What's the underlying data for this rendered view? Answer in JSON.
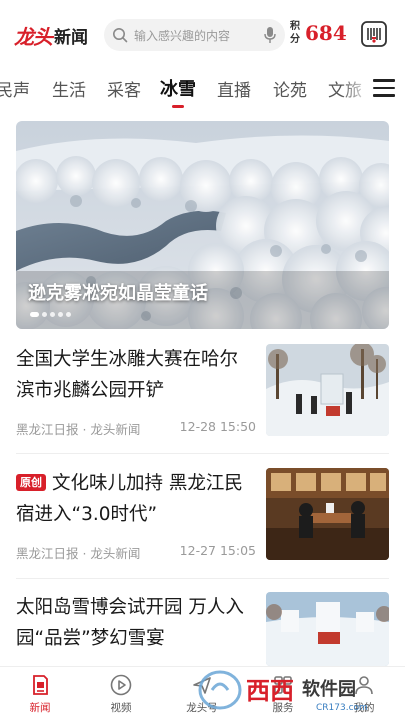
{
  "header": {
    "brand_a": "龙头",
    "brand_b": "新闻",
    "search_placeholder": "输入感兴趣的内容",
    "points_label": "积分",
    "points_value": "684"
  },
  "tabs": [
    {
      "label": "民声",
      "active": false
    },
    {
      "label": "生活",
      "active": false
    },
    {
      "label": "采客",
      "active": false
    },
    {
      "label": "冰雪",
      "active": true
    },
    {
      "label": "直播",
      "active": false
    },
    {
      "label": "论苑",
      "active": false
    },
    {
      "label": "文旅",
      "active": false
    }
  ],
  "hero": {
    "caption": "逊克雾凇宛如晶莹童话",
    "slide_count": 5,
    "active_slide": 1
  },
  "news": [
    {
      "badge": "",
      "title": "全国大学生冰雕大赛在哈尔滨市兆麟公园开铲",
      "source": "黑龙江日报 · 龙头新闻",
      "time": "12-28 15:50"
    },
    {
      "badge": "原创",
      "title": "文化味儿加持 黑龙江民宿进入“3.0时代”",
      "source": "黑龙江日报 · 龙头新闻",
      "time": "12-27 15:05"
    },
    {
      "badge": "",
      "title": "太阳岛雪博会试开园 万人入园“品尝”梦幻雪宴",
      "source": "",
      "time": ""
    }
  ],
  "bottom_nav": [
    {
      "label": "新闻",
      "icon": "news-icon",
      "active": true
    },
    {
      "label": "视频",
      "icon": "play-icon",
      "active": false
    },
    {
      "label": "龙头号",
      "icon": "account-icon",
      "active": false
    },
    {
      "label": "服务",
      "icon": "service-icon",
      "active": false
    },
    {
      "label": "我的",
      "icon": "profile-icon",
      "active": false
    }
  ],
  "watermark": {
    "text_a": "西西",
    "text_b": "软件园",
    "url": "CR173.com"
  },
  "colors": {
    "accent": "#d8202a",
    "text": "#1a1a1a",
    "muted": "#9a9a9a"
  }
}
